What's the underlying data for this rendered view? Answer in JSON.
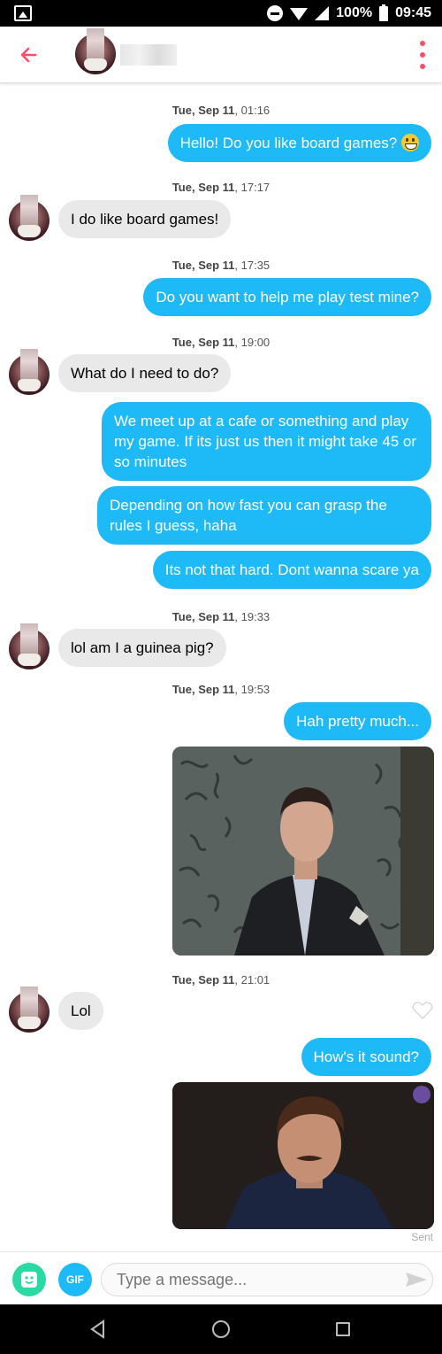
{
  "status_bar": {
    "battery": "100%",
    "time": "09:45"
  },
  "header": {
    "back_icon": "arrow-left-icon",
    "menu_icon": "kebab-menu-icon",
    "accent": "#fd5068"
  },
  "messages": [
    {
      "timestamp_day": "Tue, Sep 11",
      "timestamp_time": ", 01:16",
      "direction": "outgoing",
      "text": "Hello! Do you like board games?",
      "emoji": "grinning-face"
    },
    {
      "timestamp_day": "Tue, Sep 11",
      "timestamp_time": ", 17:17",
      "direction": "incoming",
      "text": "I do like board games!"
    },
    {
      "timestamp_day": "Tue, Sep 11",
      "timestamp_time": ", 17:35",
      "direction": "outgoing",
      "text": "Do you want to help me play test mine?"
    },
    {
      "timestamp_day": "Tue, Sep 11",
      "timestamp_time": ", 19:00",
      "direction": "incoming",
      "text": "What do I need to do?"
    },
    {
      "direction": "outgoing",
      "text": "We meet up at a cafe or something and play my game. If its just us then it might take 45 or so minutes"
    },
    {
      "direction": "outgoing",
      "text": "Depending on how fast you can grasp the rules I guess, haha"
    },
    {
      "direction": "outgoing",
      "text": "Its not that hard. Dont wanna scare ya"
    },
    {
      "timestamp_day": "Tue, Sep 11",
      "timestamp_time": ", 19:33",
      "direction": "incoming",
      "text": "lol am I a guinea pig?"
    },
    {
      "timestamp_day": "Tue, Sep 11",
      "timestamp_time": ", 19:53",
      "direction": "outgoing",
      "text": "Hah pretty much..."
    },
    {
      "direction": "outgoing",
      "type": "gif"
    },
    {
      "timestamp_day": "Tue, Sep 11",
      "timestamp_time": ", 21:01",
      "direction": "incoming",
      "text": "Lol"
    },
    {
      "direction": "outgoing",
      "text": "How's it sound?"
    },
    {
      "direction": "outgoing",
      "type": "gif"
    }
  ],
  "sent_label": "Sent",
  "composer": {
    "gif_label": "GIF",
    "placeholder": "Type a message..."
  },
  "colors": {
    "outgoing_bubble": "#1ebaf7",
    "incoming_bubble": "#e9e9e9",
    "sticker_button": "#2bd9a4"
  }
}
